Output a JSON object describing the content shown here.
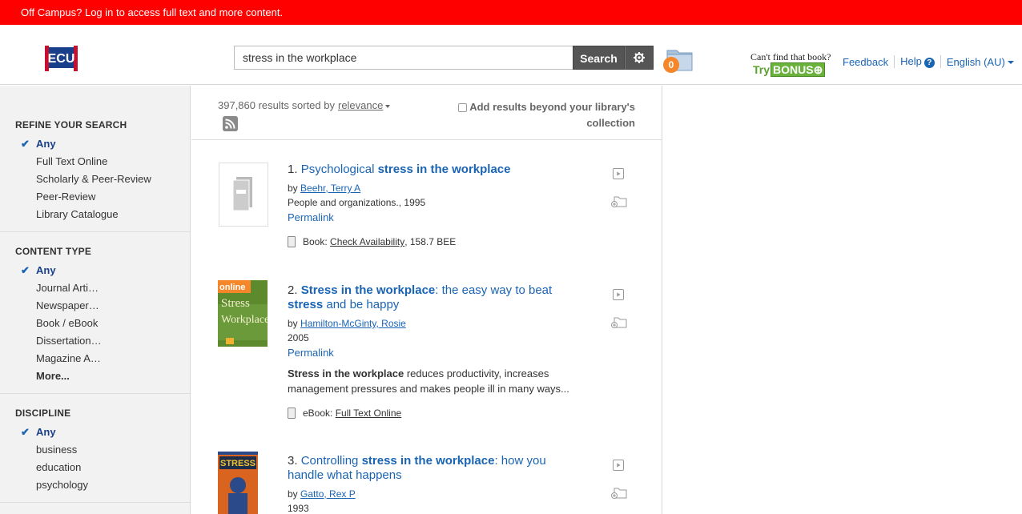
{
  "banner": {
    "text": "Off Campus? Log in to access full text and more content."
  },
  "header": {
    "logo_text": "ECU",
    "search_value": "stress in the workplace",
    "search_label": "Search",
    "folder_count": "0",
    "cant_find": "Can't find that book?",
    "try_label": "Try",
    "bonus_label": "BONUS",
    "links": {
      "feedback": "Feedback",
      "help": "Help",
      "help_q": "?",
      "language": "English (AU)"
    }
  },
  "sidebar": {
    "sections": [
      {
        "heading": "REFINE YOUR SEARCH",
        "items": [
          "Any",
          "Full Text Online",
          "Scholarly & Peer-Review",
          "Peer-Review",
          "Library Catalogue"
        ]
      },
      {
        "heading": "CONTENT TYPE",
        "items": [
          "Any",
          "Journal Arti…",
          "Newspaper…",
          "Book / eBook",
          "Dissertation…",
          "Magazine A…",
          "More..."
        ]
      },
      {
        "heading": "DISCIPLINE",
        "items": [
          "Any",
          "business",
          "education",
          "psychology"
        ]
      }
    ]
  },
  "results": {
    "count_text": "397,860 results sorted by",
    "sort_label": "relevance",
    "add_beyond": "Add results beyond your library's collection",
    "items": [
      {
        "num": "1.",
        "title_pre": "Psychological ",
        "title_bold": "stress in the workplace",
        "title_post": "",
        "by": "by",
        "author": "Beehr, Terry A",
        "source": "People and organizations., 1995",
        "permalink": "Permalink",
        "avail_type": "Book:",
        "avail_link": "Check Availability",
        "avail_extra": ", 158.7 BEE"
      },
      {
        "num": "2.",
        "title_bold": "Stress in the workplace",
        "title_post": ": the easy way to beat",
        "title_line2_bold": "stress",
        "title_line2_post": " and be happy",
        "by": "by",
        "author": "Hamilton-McGinty, Rosie",
        "source": "2005",
        "permalink": "Permalink",
        "snippet_bold": "Stress in the workplace",
        "snippet_rest": " reduces productivity, increases management pressures and makes people ill in many ways...",
        "avail_type": "eBook:",
        "avail_link": "Full Text Online",
        "thumb_badge": "online",
        "thumb_title1": "Stress",
        "thumb_title2": "Workplace"
      },
      {
        "num": "3.",
        "title_pre": "Controlling ",
        "title_bold": "stress in the workplace",
        "title_post": ": how you",
        "title_line2": "handle what happens",
        "by": "by",
        "author": "Gatto, Rex P",
        "source": "1993",
        "thumb_title": "STRESS"
      }
    ]
  }
}
